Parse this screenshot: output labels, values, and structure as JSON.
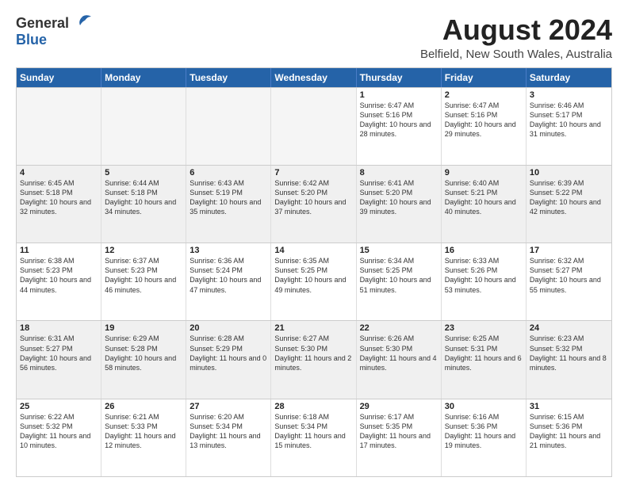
{
  "header": {
    "logo_general": "General",
    "logo_blue": "Blue",
    "main_title": "August 2024",
    "sub_title": "Belfield, New South Wales, Australia"
  },
  "days_of_week": [
    "Sunday",
    "Monday",
    "Tuesday",
    "Wednesday",
    "Thursday",
    "Friday",
    "Saturday"
  ],
  "weeks": [
    [
      {
        "day": "",
        "empty": true
      },
      {
        "day": "",
        "empty": true
      },
      {
        "day": "",
        "empty": true
      },
      {
        "day": "",
        "empty": true
      },
      {
        "day": "1",
        "sunrise": "6:47 AM",
        "sunset": "5:16 PM",
        "daylight": "10 hours and 28 minutes."
      },
      {
        "day": "2",
        "sunrise": "6:47 AM",
        "sunset": "5:16 PM",
        "daylight": "10 hours and 29 minutes."
      },
      {
        "day": "3",
        "sunrise": "6:46 AM",
        "sunset": "5:17 PM",
        "daylight": "10 hours and 31 minutes."
      }
    ],
    [
      {
        "day": "4",
        "sunrise": "6:45 AM",
        "sunset": "5:18 PM",
        "daylight": "10 hours and 32 minutes."
      },
      {
        "day": "5",
        "sunrise": "6:44 AM",
        "sunset": "5:18 PM",
        "daylight": "10 hours and 34 minutes."
      },
      {
        "day": "6",
        "sunrise": "6:43 AM",
        "sunset": "5:19 PM",
        "daylight": "10 hours and 35 minutes."
      },
      {
        "day": "7",
        "sunrise": "6:42 AM",
        "sunset": "5:20 PM",
        "daylight": "10 hours and 37 minutes."
      },
      {
        "day": "8",
        "sunrise": "6:41 AM",
        "sunset": "5:20 PM",
        "daylight": "10 hours and 39 minutes."
      },
      {
        "day": "9",
        "sunrise": "6:40 AM",
        "sunset": "5:21 PM",
        "daylight": "10 hours and 40 minutes."
      },
      {
        "day": "10",
        "sunrise": "6:39 AM",
        "sunset": "5:22 PM",
        "daylight": "10 hours and 42 minutes."
      }
    ],
    [
      {
        "day": "11",
        "sunrise": "6:38 AM",
        "sunset": "5:23 PM",
        "daylight": "10 hours and 44 minutes."
      },
      {
        "day": "12",
        "sunrise": "6:37 AM",
        "sunset": "5:23 PM",
        "daylight": "10 hours and 46 minutes."
      },
      {
        "day": "13",
        "sunrise": "6:36 AM",
        "sunset": "5:24 PM",
        "daylight": "10 hours and 47 minutes."
      },
      {
        "day": "14",
        "sunrise": "6:35 AM",
        "sunset": "5:25 PM",
        "daylight": "10 hours and 49 minutes."
      },
      {
        "day": "15",
        "sunrise": "6:34 AM",
        "sunset": "5:25 PM",
        "daylight": "10 hours and 51 minutes."
      },
      {
        "day": "16",
        "sunrise": "6:33 AM",
        "sunset": "5:26 PM",
        "daylight": "10 hours and 53 minutes."
      },
      {
        "day": "17",
        "sunrise": "6:32 AM",
        "sunset": "5:27 PM",
        "daylight": "10 hours and 55 minutes."
      }
    ],
    [
      {
        "day": "18",
        "sunrise": "6:31 AM",
        "sunset": "5:27 PM",
        "daylight": "10 hours and 56 minutes."
      },
      {
        "day": "19",
        "sunrise": "6:29 AM",
        "sunset": "5:28 PM",
        "daylight": "10 hours and 58 minutes."
      },
      {
        "day": "20",
        "sunrise": "6:28 AM",
        "sunset": "5:29 PM",
        "daylight": "11 hours and 0 minutes."
      },
      {
        "day": "21",
        "sunrise": "6:27 AM",
        "sunset": "5:30 PM",
        "daylight": "11 hours and 2 minutes."
      },
      {
        "day": "22",
        "sunrise": "6:26 AM",
        "sunset": "5:30 PM",
        "daylight": "11 hours and 4 minutes."
      },
      {
        "day": "23",
        "sunrise": "6:25 AM",
        "sunset": "5:31 PM",
        "daylight": "11 hours and 6 minutes."
      },
      {
        "day": "24",
        "sunrise": "6:23 AM",
        "sunset": "5:32 PM",
        "daylight": "11 hours and 8 minutes."
      }
    ],
    [
      {
        "day": "25",
        "sunrise": "6:22 AM",
        "sunset": "5:32 PM",
        "daylight": "11 hours and 10 minutes."
      },
      {
        "day": "26",
        "sunrise": "6:21 AM",
        "sunset": "5:33 PM",
        "daylight": "11 hours and 12 minutes."
      },
      {
        "day": "27",
        "sunrise": "6:20 AM",
        "sunset": "5:34 PM",
        "daylight": "11 hours and 13 minutes."
      },
      {
        "day": "28",
        "sunrise": "6:18 AM",
        "sunset": "5:34 PM",
        "daylight": "11 hours and 15 minutes."
      },
      {
        "day": "29",
        "sunrise": "6:17 AM",
        "sunset": "5:35 PM",
        "daylight": "11 hours and 17 minutes."
      },
      {
        "day": "30",
        "sunrise": "6:16 AM",
        "sunset": "5:36 PM",
        "daylight": "11 hours and 19 minutes."
      },
      {
        "day": "31",
        "sunrise": "6:15 AM",
        "sunset": "5:36 PM",
        "daylight": "11 hours and 21 minutes."
      }
    ]
  ],
  "labels": {
    "sunrise": "Sunrise:",
    "sunset": "Sunset:",
    "daylight": "Daylight hours"
  }
}
